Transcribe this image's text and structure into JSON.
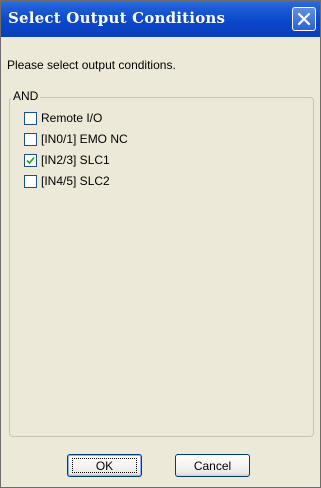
{
  "window": {
    "title": "Select Output Conditions"
  },
  "prompt": "Please select output conditions.",
  "group": {
    "label": "AND",
    "items": [
      {
        "label": "Remote I/O",
        "checked": false
      },
      {
        "label": "[IN0/1] EMO NC",
        "checked": false
      },
      {
        "label": "[IN2/3] SLC1",
        "checked": true
      },
      {
        "label": "[IN4/5] SLC2",
        "checked": false
      }
    ]
  },
  "buttons": {
    "ok": "OK",
    "cancel": "Cancel"
  },
  "icons": {
    "close": "close-icon",
    "check": "checkmark-icon"
  }
}
